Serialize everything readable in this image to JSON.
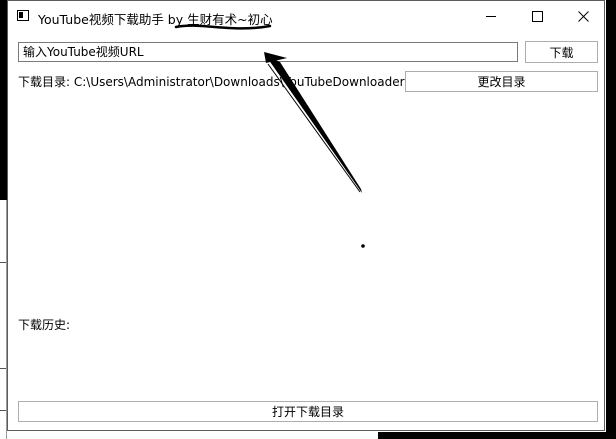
{
  "window": {
    "title": "YouTube视频下载助手 by 生财有术~初心",
    "minimize_icon": "minimize-icon",
    "maximize_icon": "maximize-icon",
    "close_icon": "close-icon"
  },
  "url_input": {
    "value": "",
    "placeholder": "输入YouTube视频URL"
  },
  "download_button": {
    "label": "下载"
  },
  "directory": {
    "label": "下载目录: C:\\Users\\Administrator\\Downloads\\YouTubeDownloader",
    "change_button_label": "更改目录"
  },
  "history": {
    "label": "下载历史:"
  },
  "open_dir_button": {
    "label": "打开下载目录"
  }
}
